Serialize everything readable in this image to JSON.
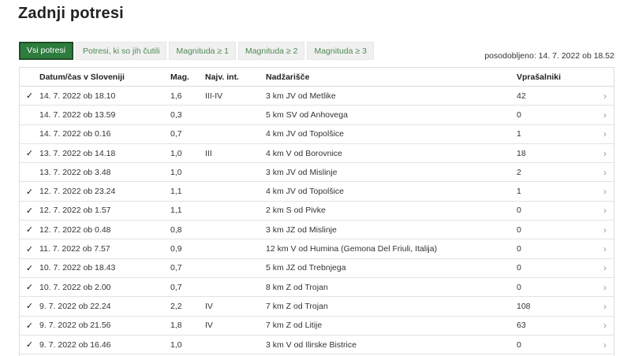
{
  "page": {
    "title": "Zadnji potresi",
    "updated": "posodobljeno: 14. 7. 2022 ob 18.52"
  },
  "filters": [
    {
      "label": "Vsi potresi",
      "active": true
    },
    {
      "label": "Potresi, ki so jih čutili",
      "active": false
    },
    {
      "label": "Magnituda ≥ 1",
      "active": false
    },
    {
      "label": "Magnituda ≥ 2",
      "active": false
    },
    {
      "label": "Magnituda ≥ 3",
      "active": false
    }
  ],
  "table": {
    "headers": {
      "time": "Datum/čas v Sloveniji",
      "mag": "Mag.",
      "intensity": "Najv. int.",
      "location": "Nadžarišče",
      "questionnaires": "Vprašalniki"
    },
    "check_symbol": "✓",
    "arrow_symbol": "›",
    "rows": [
      {
        "felt": true,
        "time": "14. 7. 2022 ob 18.10",
        "mag": "1,6",
        "intensity": "III-IV",
        "location": "3 km JV od Metlike",
        "questionnaires": "42"
      },
      {
        "felt": false,
        "time": "14. 7. 2022 ob 13.59",
        "mag": "0,3",
        "intensity": "",
        "location": "5 km SV od Anhovega",
        "questionnaires": "0"
      },
      {
        "felt": false,
        "time": "14. 7. 2022 ob 0.16",
        "mag": "0,7",
        "intensity": "",
        "location": "4 km JV od Topolšice",
        "questionnaires": "1"
      },
      {
        "felt": true,
        "time": "13. 7. 2022 ob 14.18",
        "mag": "1,0",
        "intensity": "III",
        "location": "4 km V od Borovnice",
        "questionnaires": "18"
      },
      {
        "felt": false,
        "time": "13. 7. 2022 ob 3.48",
        "mag": "1,0",
        "intensity": "",
        "location": "3 km JV od Mislinje",
        "questionnaires": "2"
      },
      {
        "felt": true,
        "time": "12. 7. 2022 ob 23.24",
        "mag": "1,1",
        "intensity": "",
        "location": "4 km JV od Topolšice",
        "questionnaires": "1"
      },
      {
        "felt": true,
        "time": "12. 7. 2022 ob 1.57",
        "mag": "1,1",
        "intensity": "",
        "location": "2 km S od Pivke",
        "questionnaires": "0"
      },
      {
        "felt": true,
        "time": "12. 7. 2022 ob 0.48",
        "mag": "0,8",
        "intensity": "",
        "location": "3 km JZ od Mislinje",
        "questionnaires": "0"
      },
      {
        "felt": true,
        "time": "11. 7. 2022 ob 7.57",
        "mag": "0,9",
        "intensity": "",
        "location": "12 km V od Humina (Gemona Del Friuli, Italija)",
        "questionnaires": "0"
      },
      {
        "felt": true,
        "time": "10. 7. 2022 ob 18.43",
        "mag": "0,7",
        "intensity": "",
        "location": "5 km JZ od Trebnjega",
        "questionnaires": "0"
      },
      {
        "felt": true,
        "time": "10. 7. 2022 ob 2.00",
        "mag": "0,7",
        "intensity": "",
        "location": "8 km Z od Trojan",
        "questionnaires": "0"
      },
      {
        "felt": true,
        "time": "9. 7. 2022 ob 22.24",
        "mag": "2,2",
        "intensity": "IV",
        "location": "7 km Z od Trojan",
        "questionnaires": "108"
      },
      {
        "felt": true,
        "time": "9. 7. 2022 ob 21.56",
        "mag": "1,8",
        "intensity": "IV",
        "location": "7 km Z od Litije",
        "questionnaires": "63"
      },
      {
        "felt": true,
        "time": "9. 7. 2022 ob 16.46",
        "mag": "1,0",
        "intensity": "",
        "location": "3 km V od Ilirske Bistrice",
        "questionnaires": "0"
      }
    ]
  },
  "colors": {
    "accent": "#2e7d3e",
    "tab_text": "#4f8a55"
  }
}
